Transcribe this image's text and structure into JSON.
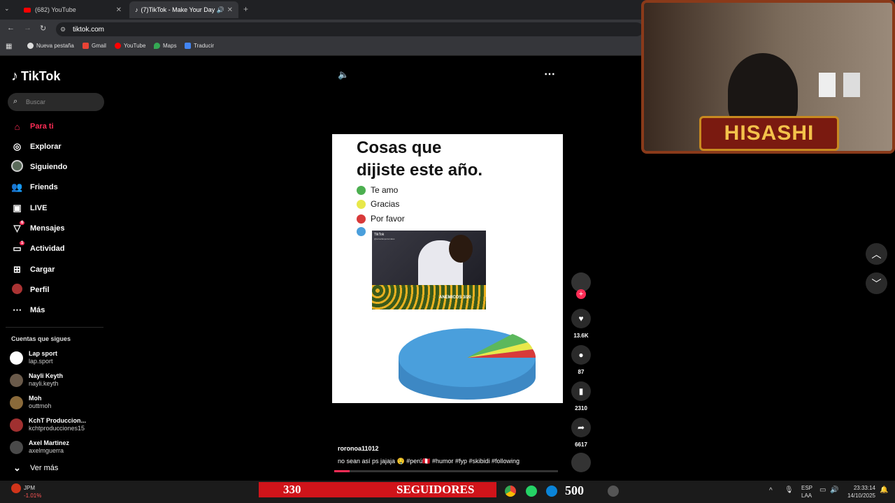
{
  "browser": {
    "tabs": [
      {
        "title": "(682) YouTube",
        "icon": "youtube-icon"
      },
      {
        "title": "(7)TikTok - Make Your Day",
        "icon": "tiktok-icon"
      }
    ],
    "url": "tiktok.com",
    "bookmarks": [
      "Nueva pestaña",
      "Gmail",
      "YouTube",
      "Maps",
      "Traducir"
    ]
  },
  "sidebar": {
    "brand": "TikTok",
    "search_placeholder": "Buscar",
    "nav": [
      {
        "label": "Para ti",
        "icon": "home-icon",
        "selected": true
      },
      {
        "label": "Explorar",
        "icon": "compass-icon"
      },
      {
        "label": "Siguiendo",
        "icon": "following-avatar-icon"
      },
      {
        "label": "Friends",
        "icon": "friends-icon"
      },
      {
        "label": "LIVE",
        "icon": "live-icon"
      },
      {
        "label": "Mensajes",
        "icon": "send-icon",
        "badge": "6"
      },
      {
        "label": "Actividad",
        "icon": "activity-icon",
        "badge": "1"
      },
      {
        "label": "Cargar",
        "icon": "upload-icon"
      },
      {
        "label": "Perfil",
        "icon": "profile-avatar-icon"
      },
      {
        "label": "Más",
        "icon": "more-icon"
      }
    ],
    "following_title": "Cuentas que sigues",
    "following": [
      {
        "name": "Lap sport",
        "handle": "lap.sport"
      },
      {
        "name": "Nayli Keyth",
        "handle": "nayli.keyth"
      },
      {
        "name": "Moh",
        "handle": "outtmoh"
      },
      {
        "name": "KchT Produccion...",
        "handle": "kchtproducciones15"
      },
      {
        "name": "Axel Martinez",
        "handle": "axelmguerra"
      }
    ],
    "see_more": "Ver más"
  },
  "video": {
    "title_line1": "Cosas que",
    "title_line2": "dijiste este año.",
    "legend": [
      {
        "label": "Te amo",
        "color": "#4caf50"
      },
      {
        "label": "Gracias",
        "color": "#e8e84a"
      },
      {
        "label": "Por favor",
        "color": "#d83a3a"
      },
      {
        "label": "",
        "color": "#4a9fdc"
      }
    ],
    "thumb_brand": "TikTok",
    "thumb_handle": "@soloellaspersonales",
    "thumb_text": "ANEMICOS 3/20",
    "pie_slices": [
      {
        "label": "Te amo",
        "fraction": 0.04
      },
      {
        "label": "Gracias",
        "fraction": 0.04
      },
      {
        "label": "Por favor",
        "fraction": 0.04
      },
      {
        "label": "",
        "fraction": 0.88
      }
    ],
    "author": "roronoa11012",
    "caption": "no sean así ps jajaja 🤤 #perú🇵🇪 #humor #fyp #skibidi #following",
    "progress": 0.07
  },
  "actions": {
    "likes": "13.6K",
    "comments": "87",
    "saves": "2310",
    "shares": "6617"
  },
  "stream": {
    "name": "HISASHI",
    "followers_count": "330",
    "followers_label": "SEGUIDORES",
    "goal": "500"
  },
  "taskbar": {
    "stock_name": "JPM",
    "stock_change": "-1.01%",
    "lang1": "ESP",
    "lang2": "LAA",
    "time": "23:33:14",
    "date": "14/10/2025"
  }
}
